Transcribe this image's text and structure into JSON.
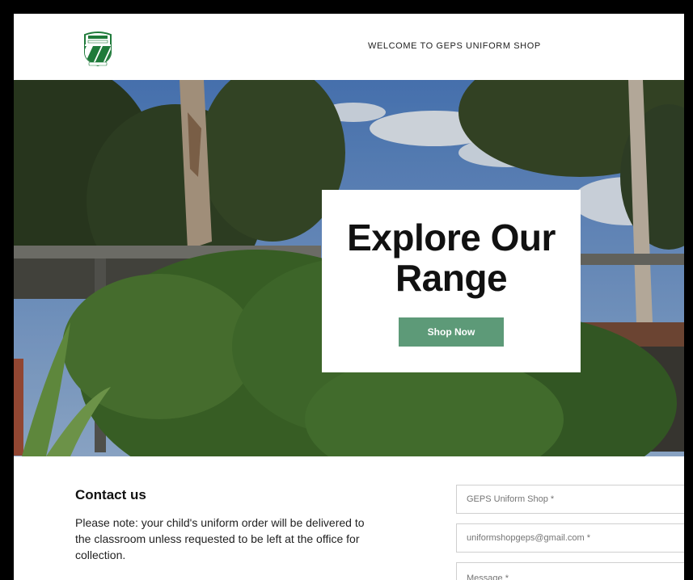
{
  "header": {
    "title": "WELCOME TO GEPS UNIFORM SHOP",
    "logo_icon": "school-crest-icon",
    "logo_text_top": "PUBLIC SCHOOL",
    "logo_text_bottom": "UNIFORM SHOP"
  },
  "hero": {
    "heading_line1": "Explore Our",
    "heading_line2": "Range",
    "button_label": "Shop Now",
    "button_color": "#5d9a78"
  },
  "contact": {
    "title": "Contact us",
    "note": "Please note: your child's uniform order will be delivered to the classroom unless requested to be left at the office for collection.",
    "form": {
      "name_placeholder": "GEPS Uniform Shop *",
      "email_placeholder": "uniformshopgeps@gmail.com *",
      "message_placeholder": "Message *"
    }
  },
  "colors": {
    "accent": "#5d9a78",
    "logo_green": "#1f7a3a"
  }
}
